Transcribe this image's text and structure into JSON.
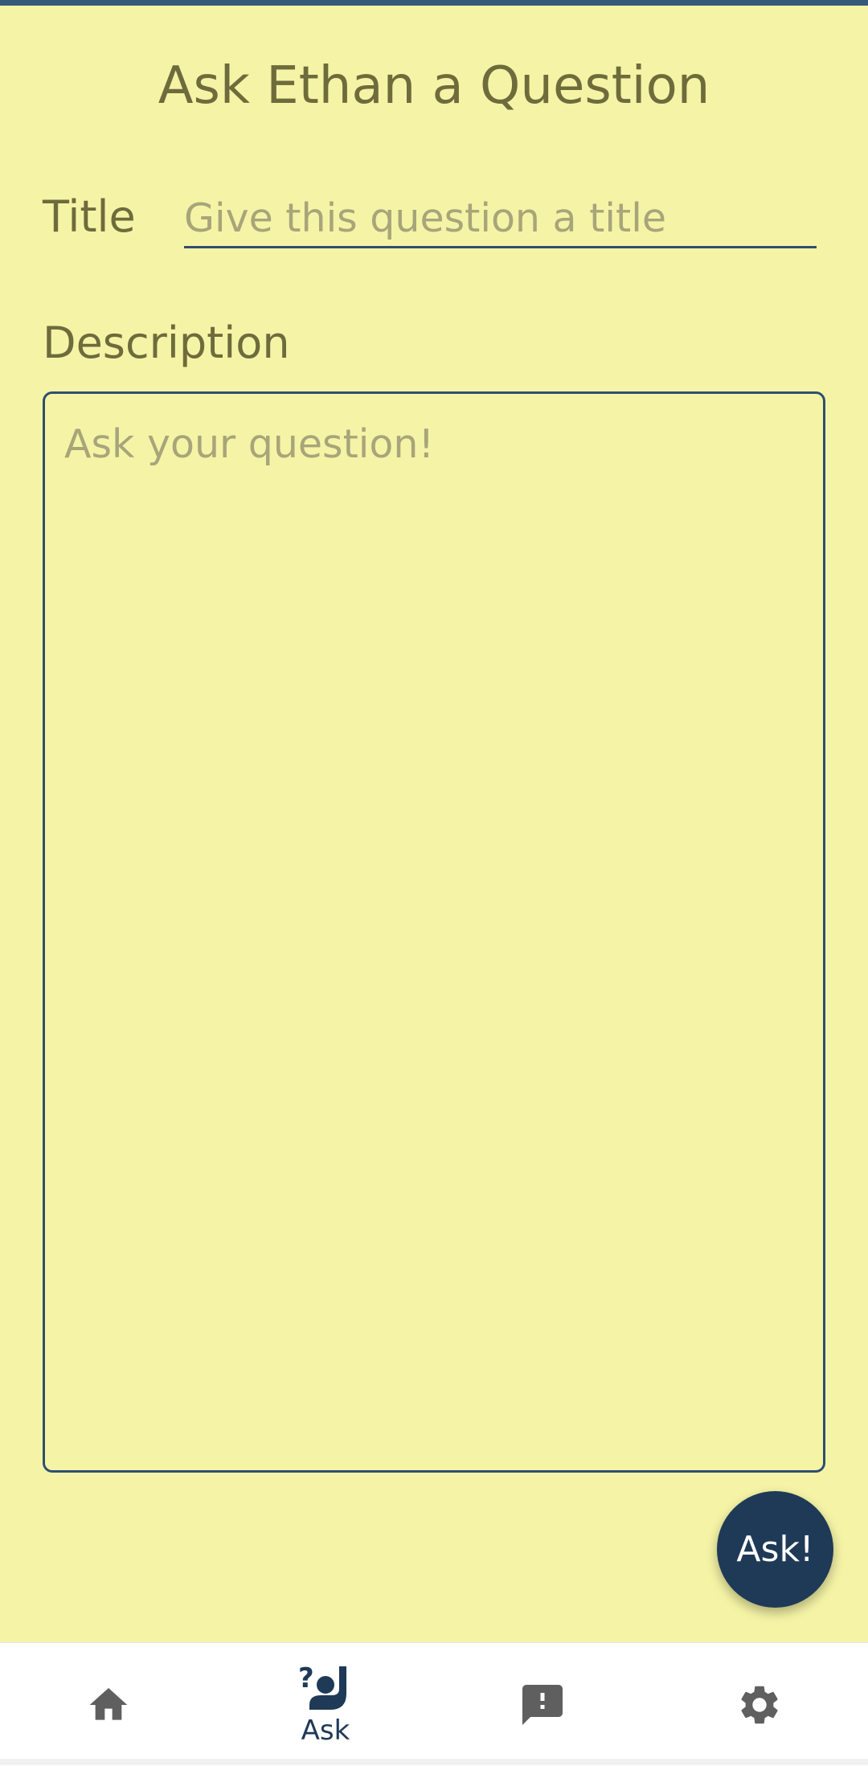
{
  "header": {
    "title": "Ask Ethan a Question"
  },
  "form": {
    "title_label": "Title",
    "title_placeholder": "Give this question a title",
    "title_value": "",
    "description_label": "Description",
    "description_placeholder": "Ask your question!",
    "description_value": ""
  },
  "fab": {
    "label": "Ask!"
  },
  "bottom_nav": {
    "items": [
      {
        "icon": "home-icon",
        "label": "",
        "selected": false
      },
      {
        "icon": "raise-hand-question-icon",
        "label": "Ask",
        "selected": true
      },
      {
        "icon": "feedback-icon",
        "label": "",
        "selected": false
      },
      {
        "icon": "settings-gear-icon",
        "label": "",
        "selected": false
      }
    ]
  },
  "colors": {
    "background": "#f5f4a6",
    "accent": "#1f3a57",
    "text": "#6e6b3c",
    "placeholder": "#a8a57a",
    "nav_inactive_icon": "#5f5f5f"
  }
}
